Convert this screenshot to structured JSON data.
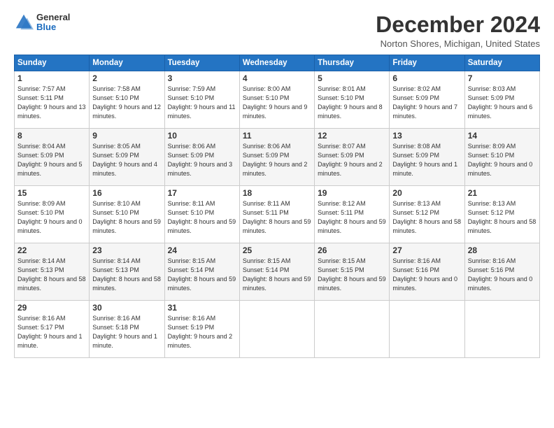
{
  "logo": {
    "general": "General",
    "blue": "Blue"
  },
  "title": "December 2024",
  "location": "Norton Shores, Michigan, United States",
  "days_header": [
    "Sunday",
    "Monday",
    "Tuesday",
    "Wednesday",
    "Thursday",
    "Friday",
    "Saturday"
  ],
  "weeks": [
    [
      {
        "day": "1",
        "sunrise": "Sunrise: 7:57 AM",
        "sunset": "Sunset: 5:11 PM",
        "daylight": "Daylight: 9 hours and 13 minutes."
      },
      {
        "day": "2",
        "sunrise": "Sunrise: 7:58 AM",
        "sunset": "Sunset: 5:10 PM",
        "daylight": "Daylight: 9 hours and 12 minutes."
      },
      {
        "day": "3",
        "sunrise": "Sunrise: 7:59 AM",
        "sunset": "Sunset: 5:10 PM",
        "daylight": "Daylight: 9 hours and 11 minutes."
      },
      {
        "day": "4",
        "sunrise": "Sunrise: 8:00 AM",
        "sunset": "Sunset: 5:10 PM",
        "daylight": "Daylight: 9 hours and 9 minutes."
      },
      {
        "day": "5",
        "sunrise": "Sunrise: 8:01 AM",
        "sunset": "Sunset: 5:10 PM",
        "daylight": "Daylight: 9 hours and 8 minutes."
      },
      {
        "day": "6",
        "sunrise": "Sunrise: 8:02 AM",
        "sunset": "Sunset: 5:09 PM",
        "daylight": "Daylight: 9 hours and 7 minutes."
      },
      {
        "day": "7",
        "sunrise": "Sunrise: 8:03 AM",
        "sunset": "Sunset: 5:09 PM",
        "daylight": "Daylight: 9 hours and 6 minutes."
      }
    ],
    [
      {
        "day": "8",
        "sunrise": "Sunrise: 8:04 AM",
        "sunset": "Sunset: 5:09 PM",
        "daylight": "Daylight: 9 hours and 5 minutes."
      },
      {
        "day": "9",
        "sunrise": "Sunrise: 8:05 AM",
        "sunset": "Sunset: 5:09 PM",
        "daylight": "Daylight: 9 hours and 4 minutes."
      },
      {
        "day": "10",
        "sunrise": "Sunrise: 8:06 AM",
        "sunset": "Sunset: 5:09 PM",
        "daylight": "Daylight: 9 hours and 3 minutes."
      },
      {
        "day": "11",
        "sunrise": "Sunrise: 8:06 AM",
        "sunset": "Sunset: 5:09 PM",
        "daylight": "Daylight: 9 hours and 2 minutes."
      },
      {
        "day": "12",
        "sunrise": "Sunrise: 8:07 AM",
        "sunset": "Sunset: 5:09 PM",
        "daylight": "Daylight: 9 hours and 2 minutes."
      },
      {
        "day": "13",
        "sunrise": "Sunrise: 8:08 AM",
        "sunset": "Sunset: 5:09 PM",
        "daylight": "Daylight: 9 hours and 1 minute."
      },
      {
        "day": "14",
        "sunrise": "Sunrise: 8:09 AM",
        "sunset": "Sunset: 5:10 PM",
        "daylight": "Daylight: 9 hours and 0 minutes."
      }
    ],
    [
      {
        "day": "15",
        "sunrise": "Sunrise: 8:09 AM",
        "sunset": "Sunset: 5:10 PM",
        "daylight": "Daylight: 9 hours and 0 minutes."
      },
      {
        "day": "16",
        "sunrise": "Sunrise: 8:10 AM",
        "sunset": "Sunset: 5:10 PM",
        "daylight": "Daylight: 8 hours and 59 minutes."
      },
      {
        "day": "17",
        "sunrise": "Sunrise: 8:11 AM",
        "sunset": "Sunset: 5:10 PM",
        "daylight": "Daylight: 8 hours and 59 minutes."
      },
      {
        "day": "18",
        "sunrise": "Sunrise: 8:11 AM",
        "sunset": "Sunset: 5:11 PM",
        "daylight": "Daylight: 8 hours and 59 minutes."
      },
      {
        "day": "19",
        "sunrise": "Sunrise: 8:12 AM",
        "sunset": "Sunset: 5:11 PM",
        "daylight": "Daylight: 8 hours and 59 minutes."
      },
      {
        "day": "20",
        "sunrise": "Sunrise: 8:13 AM",
        "sunset": "Sunset: 5:12 PM",
        "daylight": "Daylight: 8 hours and 58 minutes."
      },
      {
        "day": "21",
        "sunrise": "Sunrise: 8:13 AM",
        "sunset": "Sunset: 5:12 PM",
        "daylight": "Daylight: 8 hours and 58 minutes."
      }
    ],
    [
      {
        "day": "22",
        "sunrise": "Sunrise: 8:14 AM",
        "sunset": "Sunset: 5:13 PM",
        "daylight": "Daylight: 8 hours and 58 minutes."
      },
      {
        "day": "23",
        "sunrise": "Sunrise: 8:14 AM",
        "sunset": "Sunset: 5:13 PM",
        "daylight": "Daylight: 8 hours and 58 minutes."
      },
      {
        "day": "24",
        "sunrise": "Sunrise: 8:15 AM",
        "sunset": "Sunset: 5:14 PM",
        "daylight": "Daylight: 8 hours and 59 minutes."
      },
      {
        "day": "25",
        "sunrise": "Sunrise: 8:15 AM",
        "sunset": "Sunset: 5:14 PM",
        "daylight": "Daylight: 8 hours and 59 minutes."
      },
      {
        "day": "26",
        "sunrise": "Sunrise: 8:15 AM",
        "sunset": "Sunset: 5:15 PM",
        "daylight": "Daylight: 8 hours and 59 minutes."
      },
      {
        "day": "27",
        "sunrise": "Sunrise: 8:16 AM",
        "sunset": "Sunset: 5:16 PM",
        "daylight": "Daylight: 9 hours and 0 minutes."
      },
      {
        "day": "28",
        "sunrise": "Sunrise: 8:16 AM",
        "sunset": "Sunset: 5:16 PM",
        "daylight": "Daylight: 9 hours and 0 minutes."
      }
    ],
    [
      {
        "day": "29",
        "sunrise": "Sunrise: 8:16 AM",
        "sunset": "Sunset: 5:17 PM",
        "daylight": "Daylight: 9 hours and 1 minute."
      },
      {
        "day": "30",
        "sunrise": "Sunrise: 8:16 AM",
        "sunset": "Sunset: 5:18 PM",
        "daylight": "Daylight: 9 hours and 1 minute."
      },
      {
        "day": "31",
        "sunrise": "Sunrise: 8:16 AM",
        "sunset": "Sunset: 5:19 PM",
        "daylight": "Daylight: 9 hours and 2 minutes."
      },
      null,
      null,
      null,
      null
    ]
  ]
}
